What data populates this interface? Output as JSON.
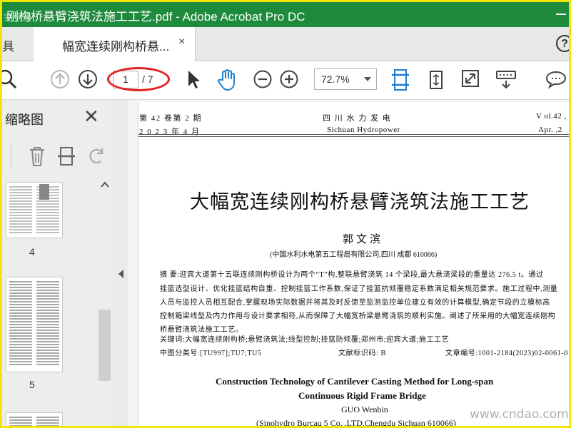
{
  "window": {
    "title": "刚构桥悬臂浇筑法施工工艺.pdf - Adobe Acrobat Pro DC",
    "watermark": "完全通"
  },
  "tabs": {
    "home_label": "具",
    "doc_label": "幅宽连续刚构桥悬...",
    "close_glyph": "×",
    "help_glyph": "?"
  },
  "toolbar": {
    "current_page": "1",
    "total_pages": "/ 7",
    "zoom": "72.7%"
  },
  "sidebar": {
    "title": "缩略图",
    "close_glyph": "✕",
    "thumbnails": [
      {
        "label": "4"
      },
      {
        "label": "5"
      }
    ]
  },
  "document": {
    "header_left_1": "第 42 卷第 2 期",
    "header_left_2": "2 0 2 3 年 4 月",
    "header_center_1": "四  川  水  力  发  电",
    "header_center_2": "Sichuan  Hydropower",
    "header_right_1": "V ol.42 ,",
    "header_right_2": "Apr. ,2",
    "title": "大幅宽连续刚构桥悬臂浇筑法施工工艺",
    "author": "郭文滨",
    "affiliation": "(中国水利水电第五工程局有限公司,四川 成都   610066)",
    "abstract_lines": [
      "摘  要:迎宾大道第十五联连续刚构桥设计为两个“T”构,整联悬臂浇筑 14 个梁段,最大悬浇梁段的重量达 276.5 t。通过",
      "挂篮选型设计、优化挂篮结构自重、控制挂篮工作系数,保证了挂篮抗倾覆稳定系数满足相关规范要求。施工过程中,测量",
      "人员与监控人员相互配合,掌握现场实际数据并将其及时反馈至监测监控单位建立有效的计算模型,确定节段的立模标高",
      "控制箱梁线型及内力作用与设计要求相符,从而保障了大幅宽桥梁悬臂浇筑的顺利实施。阐述了所采用的大幅宽连续刚构",
      "桥悬臂浇筑法施工工艺。"
    ],
    "keywords": "关键词:大幅宽连续刚构桥;悬臂浇筑法;线型控制;挂篮防倾覆;郑州市;迎宾大道;施工工艺",
    "classification": "中图分类号:[TU997];TU7;TU5",
    "doc_code": "文献标识码:   B",
    "article_no": "文章编号:1001-2184(2023)02-0061-0",
    "en_title_1": "Construction Technology of Cantilever Casting Method for Long-span",
    "en_title_2": "Continuous Rigid Frame Bridge",
    "en_author": "GUO Wenbin",
    "en_affiliation": "(Sinohydro Burcau 5 Co. ,LTD,Chengdu Sichuan 610066)"
  },
  "site_watermark": "www.cndao.com",
  "colors": {
    "titlebar": "#1e8a3c",
    "frame": "#f3e600",
    "highlight": "#e52020",
    "accent": "#1f7fd0"
  }
}
